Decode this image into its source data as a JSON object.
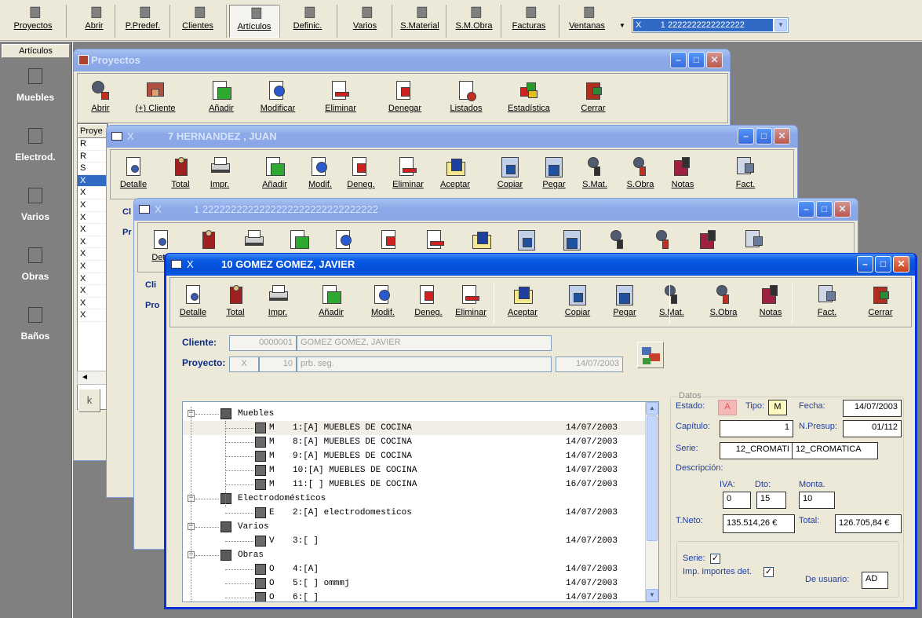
{
  "main_toolbar": {
    "items": [
      {
        "label": "Proyectos",
        "icon": "projects-icon"
      },
      {
        "label": "Abrir",
        "icon": "open-search-icon"
      },
      {
        "label": "P.Predef.",
        "icon": "predefined-icon"
      },
      {
        "label": "Clientes",
        "icon": "clients-icon"
      },
      {
        "label": "Artículos",
        "icon": "articles-icon"
      },
      {
        "label": "Definic.",
        "icon": "definitions-icon"
      },
      {
        "label": "Varios",
        "icon": "misc-icon"
      },
      {
        "label": "S.Material",
        "icon": "material-search-icon"
      },
      {
        "label": "S.M.Obra",
        "icon": "labor-search-icon"
      },
      {
        "label": "Facturas",
        "icon": "invoices-icon"
      },
      {
        "label": "Ventanas",
        "icon": "windows-icon"
      }
    ],
    "combo_prefix": "X",
    "combo_value": "1  2222222222222222"
  },
  "left_panel": {
    "header": "Artículos",
    "items": [
      {
        "label": "Muebles",
        "icon": "furniture-icon"
      },
      {
        "label": "Electrod.",
        "icon": "appliance-icon"
      },
      {
        "label": "Varios",
        "icon": "misc-items-icon"
      },
      {
        "label": "Obras",
        "icon": "works-icon"
      },
      {
        "label": "Baños",
        "icon": "bathroom-icon"
      }
    ]
  },
  "win_proyectos": {
    "title": "Proyectos",
    "tools": [
      "Abrir",
      "(+) Cliente",
      "Añadir",
      "Modificar",
      "Eliminar",
      "Denegar",
      "Listados",
      "Estadística",
      "Cerrar"
    ],
    "col_header": "Proye",
    "rows": [
      "R",
      "R",
      "S",
      "X",
      "X",
      "X",
      "X",
      "X",
      "X",
      "X",
      "X",
      "X",
      "X",
      "X",
      "X"
    ],
    "bottom_btn": "k"
  },
  "win_hernandez": {
    "title_x": "X",
    "title": "7  HERNANDEZ , JUAN",
    "tools": [
      "Detalle",
      "Total",
      "Impr.",
      "Añadir",
      "Modif.",
      "Deneg.",
      "Eliminar",
      "Aceptar",
      "Copiar",
      "Pegar",
      "S.Mat.",
      "S.Obra",
      "Notas",
      "Fact."
    ],
    "cliente_label": "Cl",
    "proyecto_label": "Pr"
  },
  "win_2222": {
    "title_x": "X",
    "title": "1  2222222222222222222222222222222",
    "tools": [
      "Deta"
    ],
    "cliente_label": "Cli",
    "proyecto_label": "Pro"
  },
  "win_gomez": {
    "title_x": "X",
    "title": "10  GOMEZ GOMEZ, JAVIER",
    "tools": [
      "Detalle",
      "Total",
      "Impr.",
      "Añadir",
      "Modif.",
      "Deneg.",
      "Eliminar",
      "Aceptar",
      "Copiar",
      "Pegar",
      "S.Mat.",
      "S.Obra",
      "Notas",
      "Fact.",
      "Cerrar"
    ],
    "cliente_label": "Cliente:",
    "cliente_code": "0000001",
    "cliente_name": "GOMEZ GOMEZ, JAVIER",
    "proyecto_label": "Proyecto:",
    "proyecto_x": "X",
    "proyecto_num": "10",
    "proyecto_name": "prb. seg.",
    "proyecto_date": "14/07/2003",
    "tree": [
      {
        "type": "group",
        "text": "Muebles"
      },
      {
        "type": "item",
        "code": "M",
        "text": "1:[A] MUEBLES DE COCINA",
        "date": "14/07/2003",
        "sel": true
      },
      {
        "type": "item",
        "code": "M",
        "text": "8:[A] MUEBLES DE COCINA",
        "date": "14/07/2003"
      },
      {
        "type": "item",
        "code": "M",
        "text": "9:[A] MUEBLES DE COCINA",
        "date": "14/07/2003"
      },
      {
        "type": "item",
        "code": "M",
        "text": "10:[A] MUEBLES DE COCINA",
        "date": "14/07/2003"
      },
      {
        "type": "item",
        "code": "M",
        "text": "11:[ ] MUEBLES DE COCINA",
        "date": "16/07/2003"
      },
      {
        "type": "group",
        "text": "Electrodomésticos"
      },
      {
        "type": "item",
        "code": "E",
        "text": "2:[A] electrodomesticos",
        "date": "14/07/2003"
      },
      {
        "type": "group",
        "text": "Varios"
      },
      {
        "type": "item",
        "code": "V",
        "text": "3:[ ]",
        "date": "14/07/2003"
      },
      {
        "type": "group",
        "text": "Obras"
      },
      {
        "type": "item",
        "code": "O",
        "text": "4:[A]",
        "date": "14/07/2003"
      },
      {
        "type": "item",
        "code": "O",
        "text": "5:[ ] ommmj",
        "date": "14/07/2003"
      },
      {
        "type": "item",
        "code": "O",
        "text": "6:[ ]",
        "date": "14/07/2003"
      }
    ],
    "datos": {
      "legend": "Datos",
      "estado_label": "Estado:",
      "estado_value": "A",
      "tipo_label": "Tipo:",
      "tipo_value": "M",
      "fecha_label": "Fecha:",
      "fecha_value": "14/07/2003",
      "capitulo_label": "Capítulo:",
      "capitulo_value": "1",
      "npresup_label": "N.Presup:",
      "npresup_value": "01/112",
      "serie_label": "Serie:",
      "serie_code": "12_CROMATI",
      "serie_name": "12_CROMATICA",
      "descripcion_label": "Descripción:",
      "iva_label": "IVA:",
      "iva_value": "0",
      "dto_label": "Dto:",
      "dto_value": "15",
      "monta_label": "Monta.",
      "monta_value": "10",
      "tneto_label": "T.Neto:",
      "tneto_value": "135.514,26 €",
      "total_label": "Total:",
      "total_value": "126.705,84 €",
      "serie_chk_label": "Serie:",
      "imp_label": "Imp. importes det.",
      "usuario_label": "De usuario:",
      "usuario_value": "AD"
    }
  }
}
